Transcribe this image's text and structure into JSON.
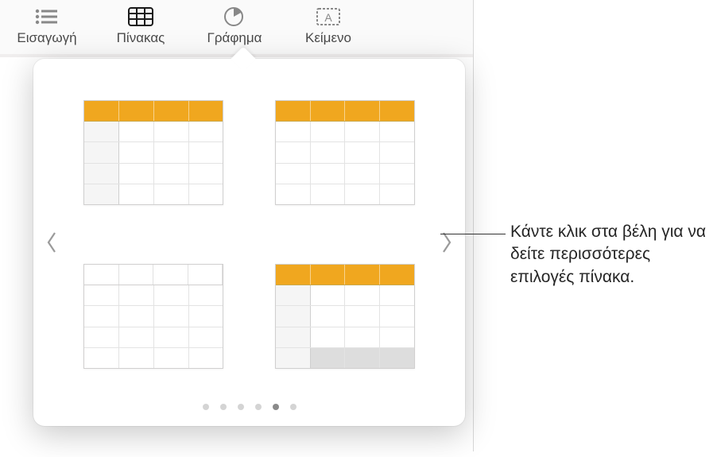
{
  "toolbar": {
    "items": [
      {
        "label": "Εισαγωγή",
        "icon": "list-icon"
      },
      {
        "label": "Πίνακας",
        "icon": "table-icon"
      },
      {
        "label": "Γράφημα",
        "icon": "chart-icon"
      },
      {
        "label": "Κείμενο",
        "icon": "text-icon"
      }
    ],
    "active_index": 1
  },
  "popover": {
    "thumbs": [
      {
        "header": "orange",
        "left_col": true,
        "footer": false,
        "cols": 4,
        "rows": 4
      },
      {
        "header": "orange",
        "left_col": false,
        "footer": false,
        "cols": 4,
        "rows": 4
      },
      {
        "header": "plain",
        "left_col": false,
        "footer": false,
        "cols": 4,
        "rows": 4
      },
      {
        "header": "orange",
        "left_col": true,
        "footer": true,
        "cols": 4,
        "rows": 4
      }
    ],
    "page_count": 6,
    "active_page": 4
  },
  "callout": {
    "text": "Κάντε κλικ στα βέλη για να δείτε περισσότερες επιλογές πίνακα."
  },
  "colors": {
    "accent_orange": "#f0a71f"
  }
}
